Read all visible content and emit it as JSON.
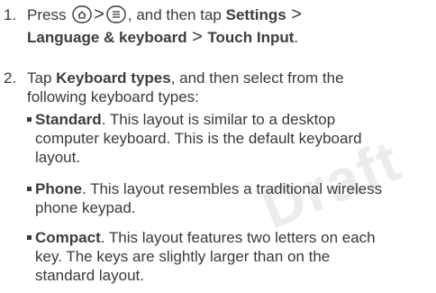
{
  "watermark": "Draft",
  "steps": [
    {
      "number": "1.",
      "press": "Press",
      "then_tap": ", and then tap",
      "settings": "Settings",
      "lang": "Language & keyboard",
      "touch": "Touch Input",
      "period": ".",
      "icons": [
        "home-icon",
        "menu-icon"
      ]
    },
    {
      "number": "2.",
      "tap": "Tap",
      "keyboard_types": "Keyboard types",
      "rest_line1": ", and then select from the",
      "rest_line2": "following keyboard types:"
    }
  ],
  "bullets": [
    {
      "term": "Standard",
      "line1": ". This layout is similar to a desktop",
      "line2": "computer keyboard. This is the default keyboard",
      "line3": "layout."
    },
    {
      "term": "Phone",
      "line1": ". This layout resembles a traditional wireless",
      "line2": "phone keypad."
    },
    {
      "term": "Compact",
      "line1": ". This layout features two letters on each",
      "line2": "key. The keys are slightly larger than on the",
      "line3": "standard layout."
    }
  ]
}
